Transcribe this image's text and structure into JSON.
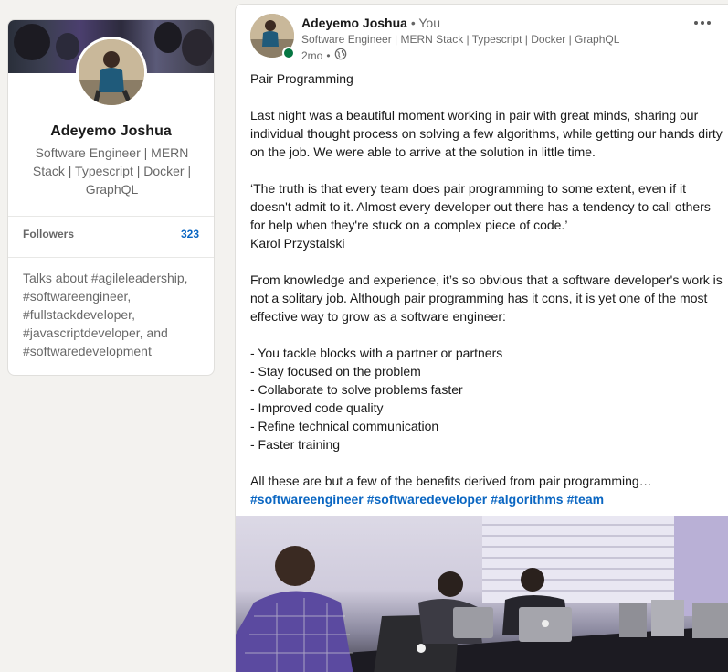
{
  "profile": {
    "name": "Adeyemo Joshua",
    "headline": "Software Engineer | MERN Stack | Typescript | Docker | GraphQL",
    "followers_label": "Followers",
    "followers_count": "323",
    "talks_about": "Talks about #agileleadership, #softwareengineer, #fullstackdeveloper, #javascriptdeveloper, and #softwaredevelopment"
  },
  "post": {
    "author_name": "Adeyemo Joshua",
    "author_badge": "• You",
    "author_headline": "Software Engineer | MERN Stack | Typescript | Docker | GraphQL",
    "time": "2mo",
    "time_sep": "•",
    "visibility_icon": "globe-icon",
    "more_icon": "ellipsis-icon",
    "paragraphs": [
      "Pair Programming",
      "",
      "Last night was a beautiful moment working in pair with great minds, sharing our individual thought process on solving a few algorithms, while getting our hands dirty on the job. We were able to arrive at the solution in little time.",
      "",
      "‘The truth is that every team does pair programming to some extent, even if it doesn't admit to it. Almost every developer out there has a tendency to call others for help when they're stuck on a complex piece of code.’",
      "Karol Przystalski",
      "",
      "From knowledge and experience, it’s so obvious that a software developer's work is not a solitary job. Although pair programming has it cons, it is yet one of the most effective way to grow as a software engineer:",
      "",
      "- You tackle blocks with a partner or partners",
      "- Stay focused on the problem",
      "- Collaborate to solve problems faster",
      "- Improved code quality",
      "- Refine technical communication",
      "- Faster training",
      "",
      "All these are but a few of the benefits derived from pair programming…"
    ],
    "hashtags": [
      "#softwareengineer",
      "#softwaredeveloper",
      "#algorithms",
      "#team"
    ]
  },
  "colors": {
    "link": "#0a66c2",
    "online": "#057642",
    "background": "#f3f2ef"
  }
}
